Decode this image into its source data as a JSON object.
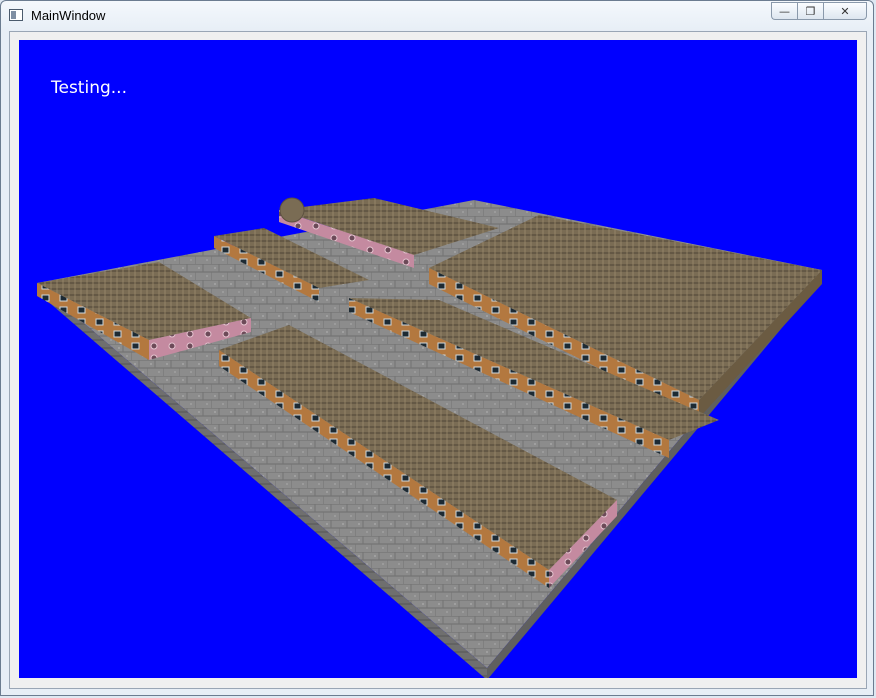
{
  "window": {
    "title": "MainWindow",
    "buttons": {
      "minimize": "—",
      "maximize": "❐",
      "close": "✕"
    }
  },
  "viewport": {
    "background_color": "#0000ff",
    "overlay_text": "Testing..."
  },
  "scene": {
    "ground_color": "#8a8a8a",
    "roof_color": "#7d6e55",
    "wall_color": "#b07a45",
    "accent_color": "#c78fa8"
  }
}
